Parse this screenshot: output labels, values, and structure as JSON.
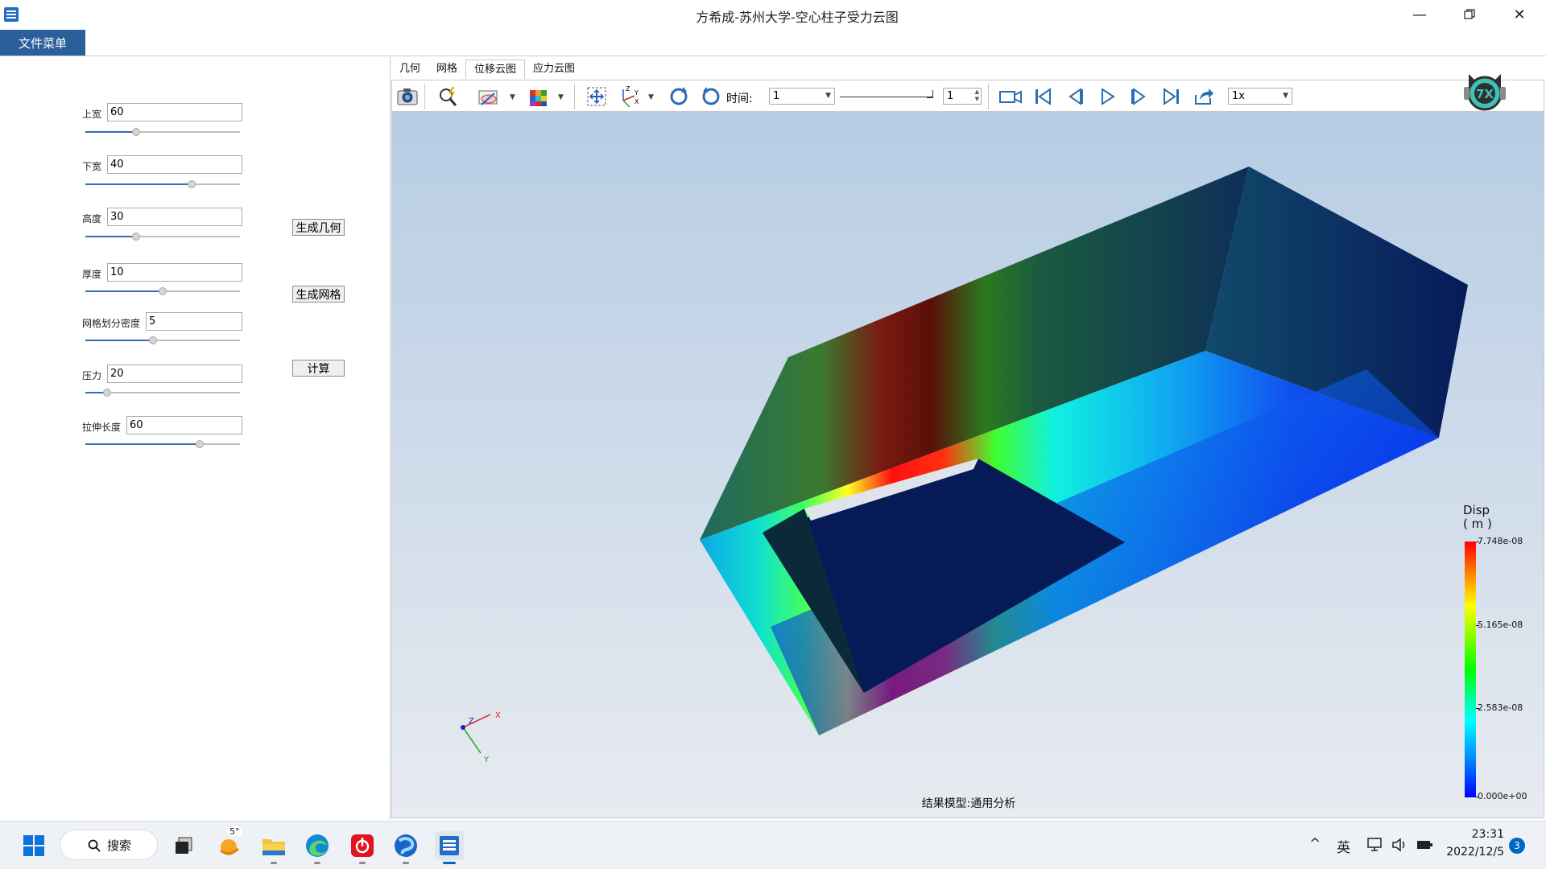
{
  "window": {
    "title": "方希成-苏州大学-空心柱子受力云图",
    "app_icon": "app-grid-icon",
    "controls": [
      "minimize-icon",
      "restore-icon",
      "close-icon"
    ]
  },
  "menubar": {
    "file_menu": "文件菜单"
  },
  "params": [
    {
      "label": "上宽",
      "value": "60",
      "fraction": 0.33
    },
    {
      "label": "下宽",
      "value": "40",
      "fraction": 0.69
    },
    {
      "label": "高度",
      "value": "30",
      "fraction": 0.33
    },
    {
      "label": "厚度",
      "value": "10",
      "fraction": 0.5
    },
    {
      "label": "网格划分密度",
      "value": "5",
      "fraction": 0.44
    },
    {
      "label": "压力",
      "value": "20",
      "fraction": 0.14
    },
    {
      "label": "拉伸长度",
      "value": "60",
      "fraction": 0.74
    }
  ],
  "actions": {
    "generate_geometry": "生成几何",
    "generate_mesh": "生成网格",
    "compute": "计算"
  },
  "tabs": [
    "几何",
    "网格",
    "位移云图",
    "应力云图"
  ],
  "active_tab": 2,
  "toolbar": {
    "time_label": "时间:",
    "time_value": "1",
    "frame_value": "1",
    "speed_value": "1x",
    "icons": [
      "camera-icon",
      "zoom-region-icon",
      "clip-plane-icon",
      "mesh-color-icon",
      "fit-view-icon",
      "axes-icon",
      "rotate-cw-icon",
      "rotate-ccw-icon",
      "record-video-icon",
      "first-frame-icon",
      "prev-frame-icon",
      "play-icon",
      "next-frame-icon",
      "last-frame-icon",
      "export-icon"
    ]
  },
  "viewport": {
    "result_label": "结果模型:通用分析",
    "axes": {
      "x": "X",
      "y": "Y",
      "z": "Z"
    },
    "legend": {
      "title_line1": "Disp",
      "title_line2": "( m )",
      "ticks": [
        "7.748e-08",
        "5.165e-08",
        "2.583e-08",
        "0.000e+00"
      ]
    }
  },
  "taskbar": {
    "search_label": "搜索",
    "weather_badge": "5°",
    "ime_label": "英",
    "time": "23:31",
    "date": "2022/12/5",
    "notification_count": "3",
    "apps": [
      "start-icon",
      "task-view-icon",
      "weather-icon",
      "file-explorer-icon",
      "edge-icon",
      "netease-music-icon",
      "browser-icon",
      "app-grid-icon"
    ]
  }
}
